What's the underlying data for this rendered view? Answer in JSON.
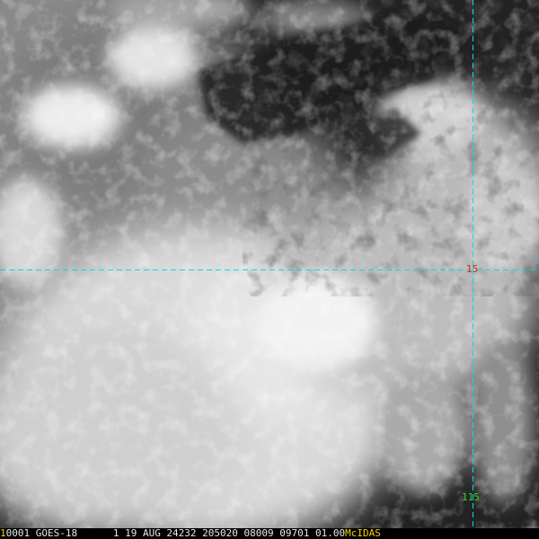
{
  "image": {
    "kind": "satellite visible imagery",
    "grid_color": "#00e0e0"
  },
  "labels": {
    "latitude": "15",
    "longitude": "115",
    "latitude_color": "#e0201c",
    "longitude_color": "#33d41a"
  },
  "status_bar": {
    "frame": "1",
    "text": "0001 GOES-18      1 19 AUG 24232 205020 08009 09701 01.00",
    "brand": "McIDAS",
    "frame_color": "#f4d000",
    "brand_color": "#f4d000"
  }
}
